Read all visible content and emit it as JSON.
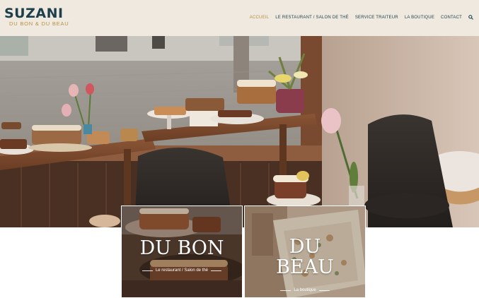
{
  "brand": {
    "name": "SUZANI",
    "tagline": "DU BON & DU BEAU",
    "primary_color": "#1d3f4b",
    "accent_color": "#b8913f"
  },
  "nav": {
    "items": [
      {
        "label": "ACCUEIL",
        "active": true
      },
      {
        "label": "LE RESTAURANT / SALON DE THÉ",
        "active": false
      },
      {
        "label": "SERVICE TRAITEUR",
        "active": false
      },
      {
        "label": "LA BOUTIQUE",
        "active": false
      },
      {
        "label": "CONTACT",
        "active": false
      }
    ],
    "search_icon": "search-icon"
  },
  "tiles": [
    {
      "title": "DU BON",
      "caption": "Le restaurant / Salon de thé"
    },
    {
      "title": "DU\nBEAU",
      "caption": "La boutique"
    }
  ]
}
